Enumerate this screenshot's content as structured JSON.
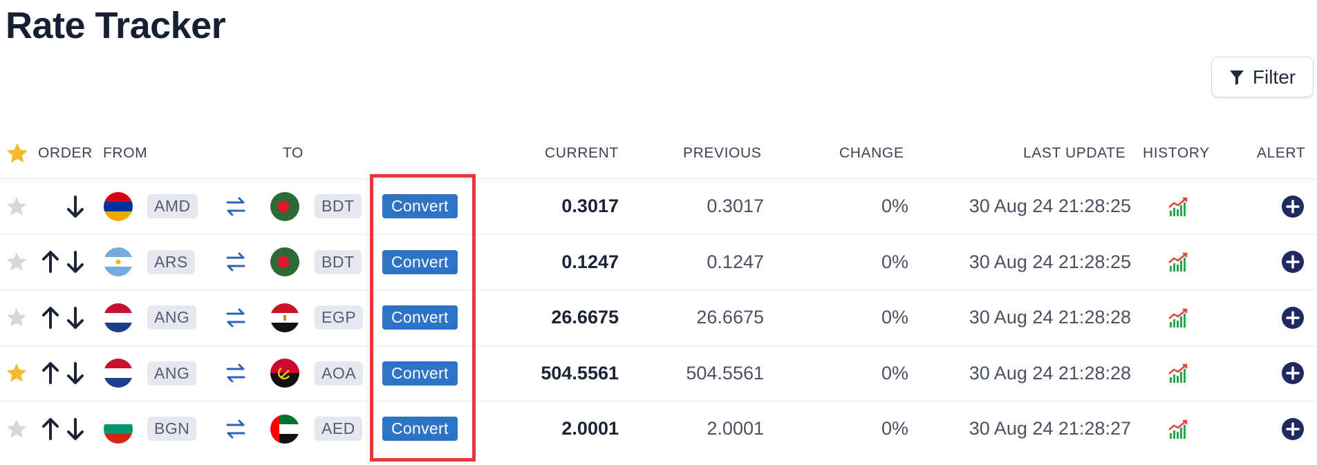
{
  "page": {
    "title": "Rate Tracker"
  },
  "toolbar": {
    "filter_label": "Filter",
    "filter_icon": "funnel-icon"
  },
  "columns": {
    "favorite_icon": "star-icon",
    "order": "ORDER",
    "from": "FROM",
    "to": "TO",
    "current": "CURRENT",
    "previous": "PREVIOUS",
    "change": "CHANGE",
    "last_update": "LAST UPDATE",
    "history": "HISTORY",
    "alert": "ALERT"
  },
  "colors": {
    "accent": "#2d74c7",
    "star_active": "#f5b82e",
    "star_inactive": "#d5d7dc",
    "highlight": "#e8393a",
    "alert_button": "#1f2a60"
  },
  "rows": [
    {
      "favorite": false,
      "order_up": false,
      "order_down": true,
      "from_flag": "am",
      "from": "AMD",
      "to_flag": "bd",
      "to": "BDT",
      "convert_label": "Convert",
      "current": "0.3017",
      "previous": "0.3017",
      "change": "0%",
      "last_update": "30 Aug 24 21:28:25"
    },
    {
      "favorite": false,
      "order_up": true,
      "order_down": true,
      "from_flag": "ar",
      "from": "ARS",
      "to_flag": "bd",
      "to": "BDT",
      "convert_label": "Convert",
      "current": "0.1247",
      "previous": "0.1247",
      "change": "0%",
      "last_update": "30 Aug 24 21:28:25"
    },
    {
      "favorite": false,
      "order_up": true,
      "order_down": true,
      "from_flag": "nl",
      "from": "ANG",
      "to_flag": "eg",
      "to": "EGP",
      "convert_label": "Convert",
      "current": "26.6675",
      "previous": "26.6675",
      "change": "0%",
      "last_update": "30 Aug 24 21:28:28"
    },
    {
      "favorite": true,
      "order_up": true,
      "order_down": true,
      "from_flag": "nl",
      "from": "ANG",
      "to_flag": "ao",
      "to": "AOA",
      "convert_label": "Convert",
      "current": "504.5561",
      "previous": "504.5561",
      "change": "0%",
      "last_update": "30 Aug 24 21:28:28"
    },
    {
      "favorite": false,
      "order_up": true,
      "order_down": true,
      "from_flag": "bg",
      "from": "BGN",
      "to_flag": "ae",
      "to": "AED",
      "convert_label": "Convert",
      "current": "2.0001",
      "previous": "2.0001",
      "change": "0%",
      "last_update": "30 Aug 24 21:28:27"
    }
  ]
}
